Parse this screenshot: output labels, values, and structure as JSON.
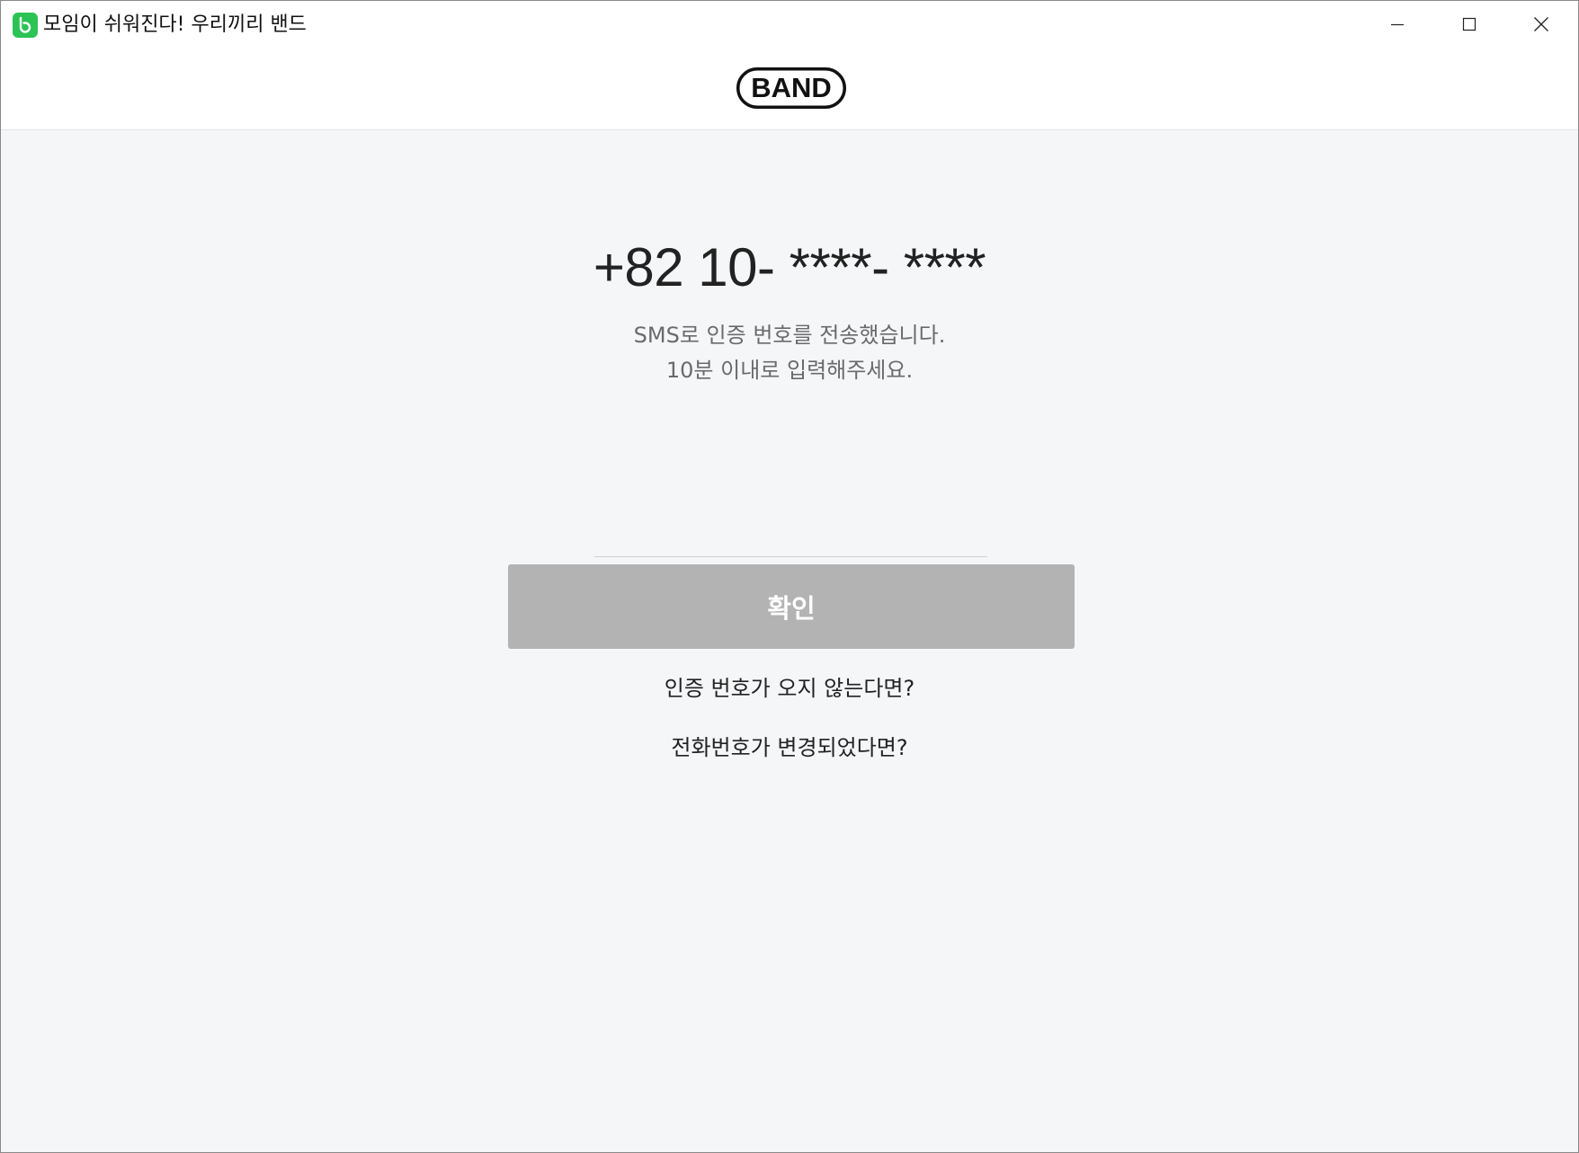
{
  "window": {
    "title": "모임이 쉬워진다! 우리끼리 밴드",
    "app_icon": "band-app-icon",
    "controls": {
      "minimize_icon": "minimize-icon",
      "maximize_icon": "maximize-icon",
      "close_icon": "close-icon"
    }
  },
  "header": {
    "logo_text": "BAND"
  },
  "verification": {
    "phone_number": "+82 10- ****- ****",
    "message_line1": "SMS로 인증 번호를 전송했습니다.",
    "message_line2": "10분 이내로 입력해주세요.",
    "code_value": "",
    "confirm_label": "확인",
    "no_code_link": "인증 번호가 오지 않는다면?",
    "changed_number_link": "전화번호가 변경되었다면?"
  },
  "colors": {
    "background": "#f5f6f8",
    "header_background": "#ffffff",
    "button_disabled": "#b3b3b3",
    "app_icon_green": "#2cc355",
    "text_primary": "#222222",
    "text_secondary": "#6a6a6a"
  }
}
